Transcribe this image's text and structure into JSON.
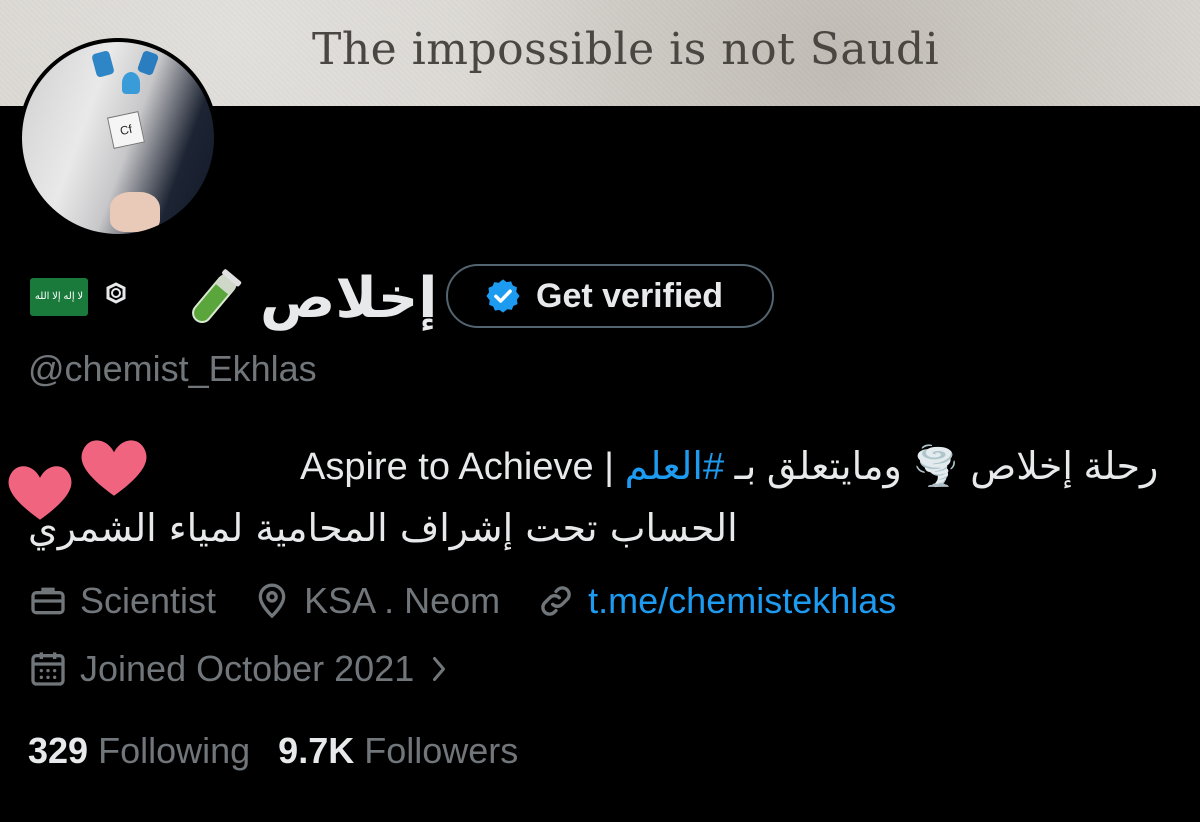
{
  "banner": {
    "text": "The impossible is not Saudi"
  },
  "profile": {
    "name": "إخلاص",
    "flag_label": "لا إله إلا الله",
    "get_verified_label": "Get verified",
    "handle": "@chemist_Ekhlas"
  },
  "bio": {
    "line1_text": "Aspire to Achieve | رحلة إخلاص 🌪️ ومايتعلق بـ ",
    "line1_hashtag": "#العلم",
    "line2_text": "الحساب تحت إشراف المحامية لمياء الشمري"
  },
  "meta": {
    "profession": "Scientist",
    "location": "KSA . Neom",
    "link": "t.me/chemistekhlas",
    "joined": "Joined October 2021"
  },
  "stats": {
    "following_count": "329",
    "following_label": "Following",
    "followers_count": "9.7K",
    "followers_label": "Followers"
  },
  "colors": {
    "background": "#000000",
    "text_primary": "#e7e9ea",
    "text_secondary": "#71767b",
    "link": "#1d9bf0",
    "verified_badge": "#1d9bf0",
    "border": "#536471",
    "hearts": "#f0647f"
  },
  "icons": [
    "saudi-flag-icon",
    "benzene-ring-icon",
    "test-tube-icon",
    "verified-badge-icon",
    "briefcase-icon",
    "location-pin-icon",
    "link-icon",
    "calendar-icon",
    "chevron-right-icon",
    "heart-icon"
  ]
}
